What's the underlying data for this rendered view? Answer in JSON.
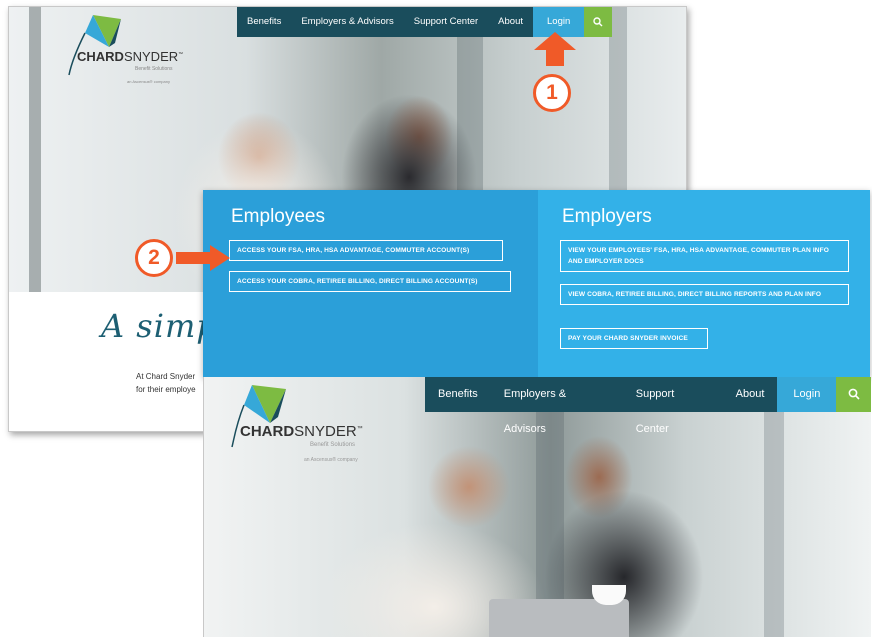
{
  "brand": {
    "name_bold": "CHARD",
    "name_light": "SNYDER",
    "tm": "™",
    "sub": "Benefit Solutions",
    "parent": "an Ascensus® company"
  },
  "nav": {
    "benefits": "Benefits",
    "employers": "Employers & Advisors",
    "support": "Support Center",
    "about": "About",
    "login": "Login",
    "search_icon": "magnifier"
  },
  "hero": {
    "tagline": "A simple",
    "intro_line1": "At Chard Snyder",
    "intro_line2": "for their employe"
  },
  "dropdown": {
    "employees_title": "Employees",
    "employees_options": [
      "ACCESS YOUR FSA, HRA, HSA ADVANTAGE, COMMUTER ACCOUNT(S)",
      "ACCESS YOUR COBRA, RETIREE BILLING, DIRECT BILLING ACCOUNT(S)"
    ],
    "employers_title": "Employers",
    "employers_options": [
      "VIEW YOUR EMPLOYEES' FSA, HRA, HSA ADVANTAGE, COMMUTER PLAN INFO AND EMPLOYER DOCS",
      "VIEW COBRA, RETIREE BILLING, DIRECT BILLING REPORTS AND PLAN INFO",
      "PAY YOUR CHARD SNYDER INVOICE"
    ]
  },
  "annotations": {
    "step1": "1",
    "step2": "2",
    "color": "#f05a28"
  },
  "colors": {
    "nav_dark": "#1a4d5c",
    "login_blue": "#36a8d8",
    "search_green": "#7dbb42",
    "panel_left": "#2b9fd9",
    "panel_right": "#33b1e8"
  }
}
